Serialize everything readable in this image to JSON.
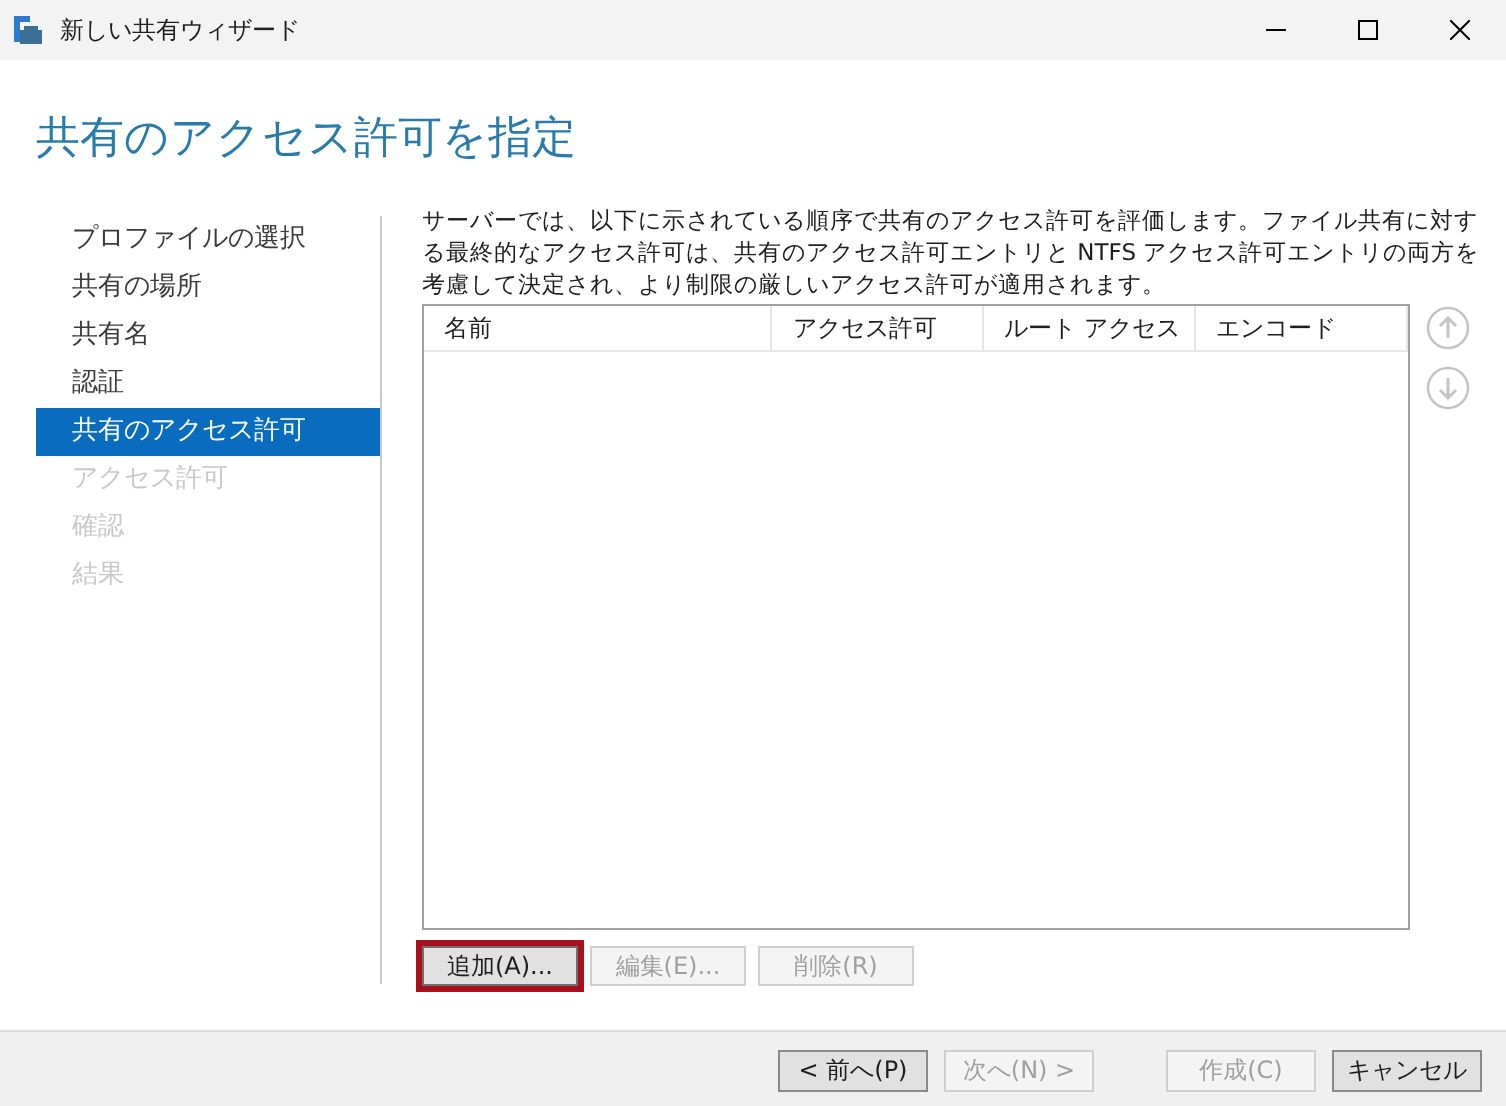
{
  "window": {
    "title": "新しい共有ウィザード"
  },
  "heading": "共有のアクセス許可を指定",
  "steps": [
    {
      "label": "プロファイルの選択",
      "selected": false,
      "disabled": false
    },
    {
      "label": "共有の場所",
      "selected": false,
      "disabled": false
    },
    {
      "label": "共有名",
      "selected": false,
      "disabled": false
    },
    {
      "label": "認証",
      "selected": false,
      "disabled": false
    },
    {
      "label": "共有のアクセス許可",
      "selected": true,
      "disabled": false
    },
    {
      "label": "アクセス許可",
      "selected": false,
      "disabled": true
    },
    {
      "label": "確認",
      "selected": false,
      "disabled": true
    },
    {
      "label": "結果",
      "selected": false,
      "disabled": true
    }
  ],
  "description": "サーバーでは、以下に示されている順序で共有のアクセス許可を評価します。ファイル共有に対する最終的なアクセス許可は、共有のアクセス許可エントリと NTFS アクセス許可エントリの両方を考慮して決定され、より制限の厳しいアクセス許可が適用されます。",
  "table": {
    "columns": [
      "名前",
      "アクセス許可",
      "ルート アクセス",
      "エンコード"
    ]
  },
  "move_buttons": [
    {
      "kind": "up",
      "disabled": true
    },
    {
      "kind": "down",
      "disabled": true
    }
  ],
  "table_buttons": [
    {
      "label": "追加(A)...",
      "disabled": false,
      "highlighted": true
    },
    {
      "label": "編集(E)...",
      "disabled": true,
      "highlighted": false
    },
    {
      "label": "削除(R)",
      "disabled": true,
      "highlighted": false
    }
  ],
  "footer_buttons": [
    {
      "label": "< 前へ(P)",
      "disabled": false
    },
    {
      "label": "次へ(N) >",
      "disabled": true
    },
    {
      "label": "作成(C)",
      "disabled": true
    },
    {
      "label": "キャンセル",
      "disabled": false
    }
  ]
}
